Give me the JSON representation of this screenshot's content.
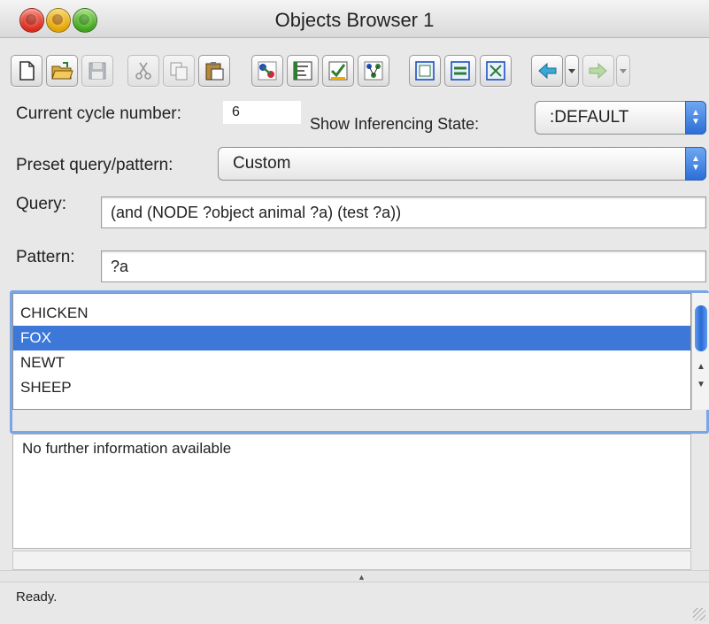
{
  "window": {
    "title": "Objects Browser 1"
  },
  "toolbar": {
    "buttons": [
      "new-file-icon",
      "open-folder-icon",
      "save-icon",
      "cut-icon",
      "copy-icon",
      "paste-icon",
      "graph-color-icon",
      "view-frame-icon",
      "check-icon",
      "tree-icon",
      "panel-a-icon",
      "panel-b-icon",
      "panel-c-icon",
      "back-arrow-icon",
      "forward-arrow-icon"
    ]
  },
  "cycle": {
    "label": "Current cycle number:",
    "value": "6"
  },
  "inferencing": {
    "label": "Show Inferencing State:",
    "selected": ":DEFAULT"
  },
  "preset": {
    "label": "Preset query/pattern:",
    "selected": "Custom"
  },
  "query": {
    "label": "Query:",
    "value": "(and (NODE ?object animal ?a) (test ?a))"
  },
  "pattern": {
    "label": "Pattern:",
    "value": "?a"
  },
  "results": {
    "items": [
      {
        "label": "CHICKEN",
        "selected": false
      },
      {
        "label": "FOX",
        "selected": true
      },
      {
        "label": "NEWT",
        "selected": false
      },
      {
        "label": "SHEEP",
        "selected": false
      }
    ]
  },
  "info": {
    "text": "No further information available"
  },
  "status": {
    "text": "Ready."
  },
  "colors": {
    "selection": "#3d78d8",
    "accent": "#2c6ed8"
  }
}
